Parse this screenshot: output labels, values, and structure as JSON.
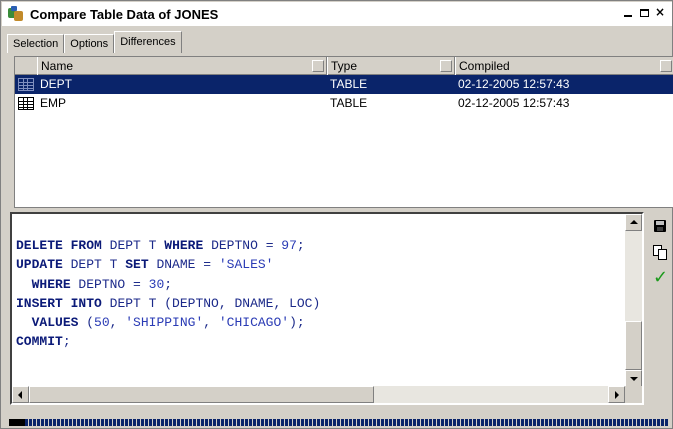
{
  "window": {
    "title": "Compare Table Data of JONES",
    "controls": [
      "_",
      "□",
      "×"
    ]
  },
  "tabs": [
    {
      "label": "Selection",
      "active": false
    },
    {
      "label": "Options",
      "active": false
    },
    {
      "label": "Differences",
      "active": true
    }
  ],
  "grid": {
    "columns": [
      "Name",
      "Type",
      "Compiled"
    ],
    "rows": [
      {
        "name": "DEPT",
        "type": "TABLE",
        "compiled": "02-12-2005 12:57:43",
        "selected": true,
        "icon": "table-icon"
      },
      {
        "name": "EMP",
        "type": "TABLE",
        "compiled": "02-12-2005 12:57:43",
        "selected": false,
        "icon": "table-icon"
      }
    ]
  },
  "editor": {
    "lines": [
      "DELETE FROM DEPT T WHERE DEPTNO = 97;",
      "UPDATE DEPT T SET DNAME = 'SALES'",
      "  WHERE DEPTNO = 30;",
      "INSERT INTO DEPT T (DEPTNO, DNAME, LOC)",
      "  VALUES (50, 'SHIPPING', 'CHICAGO');",
      "COMMIT;"
    ]
  },
  "side_tools": [
    {
      "name": "save",
      "icon": "save-icon"
    },
    {
      "name": "copy",
      "icon": "copy-icon"
    },
    {
      "name": "apply",
      "icon": "check-icon"
    }
  ],
  "colors": {
    "selection": "#0a246a",
    "sql_keyword": "#0b1a78",
    "sql_text": "#1c2a8a",
    "check": "#1c9a1c"
  }
}
